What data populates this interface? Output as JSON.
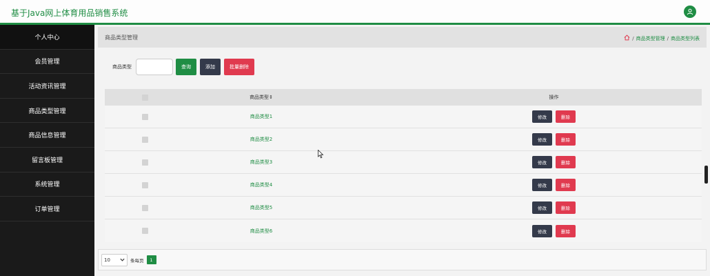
{
  "app": {
    "title": "基于Java网上体育用品销售系统"
  },
  "sidebar": {
    "items": [
      {
        "label": "个人中心"
      },
      {
        "label": "会员管理"
      },
      {
        "label": "活动资讯管理"
      },
      {
        "label": "商品类型管理"
      },
      {
        "label": "商品信息管理"
      },
      {
        "label": "留言板管理"
      },
      {
        "label": "系统管理"
      },
      {
        "label": "订单管理"
      }
    ]
  },
  "header": {
    "page_title": "商品类型管理",
    "breadcrumb": [
      "商品类型管理",
      "商品类型列表"
    ],
    "separator": "/"
  },
  "search": {
    "label": "商品类型",
    "value": "",
    "query_label": "查询",
    "add_label": "添加",
    "batch_delete_label": "批量删除"
  },
  "table": {
    "headers": {
      "name": "商品类型",
      "sort_icon": "⇕",
      "action": "操作"
    },
    "rows": [
      {
        "name": "商品类型1"
      },
      {
        "name": "商品类型2"
      },
      {
        "name": "商品类型3"
      },
      {
        "name": "商品类型4"
      },
      {
        "name": "商品类型5"
      },
      {
        "name": "商品类型6"
      }
    ],
    "edit_label": "修改",
    "delete_label": "删除"
  },
  "pagination": {
    "page_size": "10",
    "per_page_label": "条每页",
    "current_page": "1"
  },
  "colors": {
    "accent": "#1f8d44",
    "danger": "#e03a4f",
    "dark_button": "#343a4a",
    "sidebar": "#1a1a1a"
  },
  "icons": {
    "avatar": "user-icon",
    "home": "home-icon",
    "dropdown": "chevron-down-icon"
  }
}
